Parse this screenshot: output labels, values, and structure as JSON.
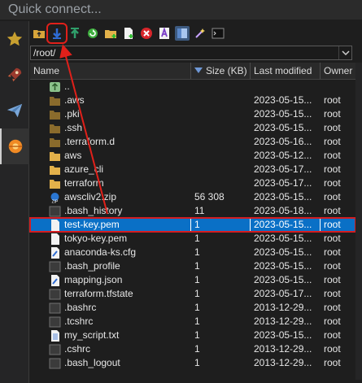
{
  "quick_connect": {
    "placeholder": "Quick connect..."
  },
  "side_tabs": [
    {
      "name": "favorites-tab",
      "icon": "star-icon"
    },
    {
      "name": "tools-tab",
      "icon": "rocket-icon"
    },
    {
      "name": "send-tab",
      "icon": "paper-plane-icon"
    },
    {
      "name": "sftp-tab",
      "icon": "sftp-orb-icon"
    }
  ],
  "toolbar": {
    "buttons": [
      "parent-folder",
      "download",
      "upload",
      "refresh",
      "new-folder",
      "new-file",
      "delete",
      "properties",
      "toggle-view",
      "magic",
      "terminal"
    ]
  },
  "path": {
    "value": "/root/"
  },
  "columns": {
    "name": "Name",
    "size": "Size (KB)",
    "modified": "Last modified",
    "owner": "Owner"
  },
  "files": [
    {
      "name": "..",
      "size": "",
      "modified": "",
      "owner": "",
      "type": "up"
    },
    {
      "name": ".aws",
      "size": "",
      "modified": "2023-05-15...",
      "owner": "root",
      "type": "folder-dark"
    },
    {
      "name": ".pki",
      "size": "",
      "modified": "2023-05-15...",
      "owner": "root",
      "type": "folder-dark"
    },
    {
      "name": ".ssh",
      "size": "",
      "modified": "2023-05-15...",
      "owner": "root",
      "type": "folder-dark"
    },
    {
      "name": ".terraform.d",
      "size": "",
      "modified": "2023-05-16...",
      "owner": "root",
      "type": "folder-dark"
    },
    {
      "name": "aws",
      "size": "",
      "modified": "2023-05-12...",
      "owner": "root",
      "type": "folder"
    },
    {
      "name": "azure_cli",
      "size": "",
      "modified": "2023-05-17...",
      "owner": "root",
      "type": "folder"
    },
    {
      "name": "terraform",
      "size": "",
      "modified": "2023-05-17...",
      "owner": "root",
      "type": "folder"
    },
    {
      "name": "awscliv2.zip",
      "size": "56 308",
      "modified": "2023-05-15...",
      "owner": "root",
      "type": "zip"
    },
    {
      "name": ".bash_history",
      "size": "11",
      "modified": "2023-05-18...",
      "owner": "root",
      "type": "dark"
    },
    {
      "name": "test-key.pem",
      "size": "1",
      "modified": "2023-05-15...",
      "owner": "root",
      "type": "pem",
      "selected": true
    },
    {
      "name": "tokyo-key.pem",
      "size": "1",
      "modified": "2023-05-15...",
      "owner": "root",
      "type": "pem"
    },
    {
      "name": "anaconda-ks.cfg",
      "size": "1",
      "modified": "2023-05-15...",
      "owner": "root",
      "type": "cfg"
    },
    {
      "name": ".bash_profile",
      "size": "1",
      "modified": "2023-05-15...",
      "owner": "root",
      "type": "dark"
    },
    {
      "name": "mapping.json",
      "size": "1",
      "modified": "2023-05-15...",
      "owner": "root",
      "type": "cfg"
    },
    {
      "name": "terraform.tfstate",
      "size": "1",
      "modified": "2023-05-17...",
      "owner": "root",
      "type": "dark"
    },
    {
      "name": ".bashrc",
      "size": "1",
      "modified": "2013-12-29...",
      "owner": "root",
      "type": "dark"
    },
    {
      "name": ".tcshrc",
      "size": "1",
      "modified": "2013-12-29...",
      "owner": "root",
      "type": "dark"
    },
    {
      "name": "my_script.txt",
      "size": "1",
      "modified": "2023-05-15...",
      "owner": "root",
      "type": "txt"
    },
    {
      "name": ".cshrc",
      "size": "1",
      "modified": "2013-12-29...",
      "owner": "root",
      "type": "dark"
    },
    {
      "name": ".bash_logout",
      "size": "1",
      "modified": "2013-12-29...",
      "owner": "root",
      "type": "dark"
    }
  ],
  "colors": {
    "selection": "#0a70c6",
    "highlight": "#e0201a",
    "folder": "#e3b14a",
    "folder_dark": "#8a6b2c"
  }
}
